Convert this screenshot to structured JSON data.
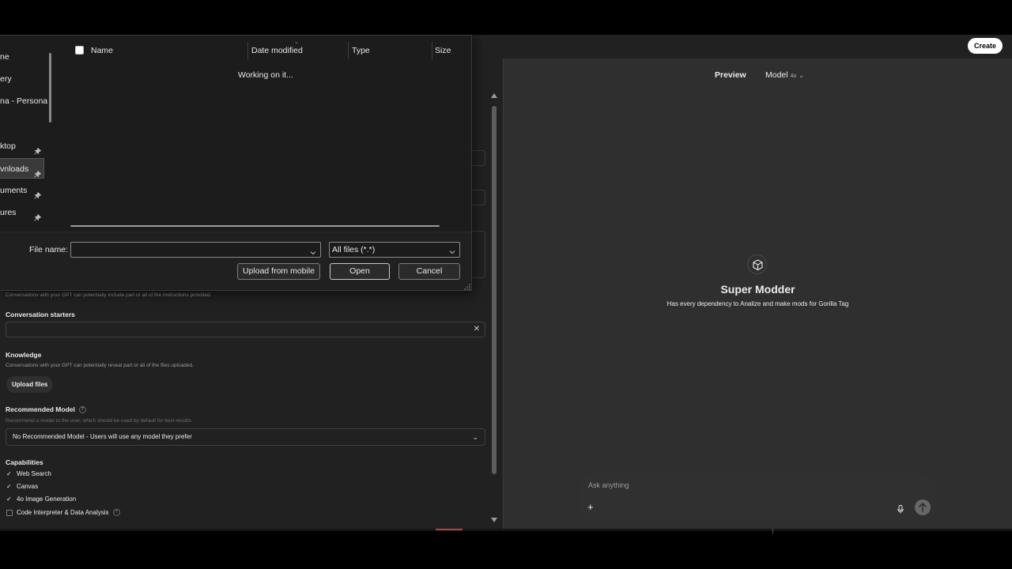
{
  "topbar": {
    "create_label": "Create"
  },
  "builder": {
    "instructions_hint": "Conversations with your GPT can potentially include part or all of the instructions provided.",
    "starters": {
      "label": "Conversation starters",
      "input_value": ""
    },
    "knowledge": {
      "label": "Knowledge",
      "hint": "Conversations with your GPT can potentially reveal part or all of the files uploaded.",
      "upload_label": "Upload files"
    },
    "recommended_model": {
      "label": "Recommended Model",
      "help": "?",
      "hint": "Recommend a model to the user, which should be used by default for best results.",
      "selected": "No Recommended Model - Users will use any model they prefer"
    },
    "capabilities": {
      "label": "Capabilities",
      "items": [
        {
          "label": "Web Search",
          "checked": true,
          "mark": "✓"
        },
        {
          "label": "Canvas",
          "checked": true,
          "mark": "✓"
        },
        {
          "label": "4o Image Generation",
          "checked": true,
          "mark": "✓"
        },
        {
          "label": "Code Interpreter & Data Analysis",
          "checked": false,
          "mark": "",
          "help": "?"
        }
      ]
    }
  },
  "preview": {
    "tab_label": "Preview",
    "model_label": "Model",
    "model_version": "4o",
    "gpt_name": "Super Modder",
    "gpt_description": "Has every dependency to Analize and make mods for Gorilla Tag",
    "composer_placeholder": "Ask anything",
    "plus": "+"
  },
  "file_dialog": {
    "nav_items": [
      {
        "label": "ne",
        "pinned": false
      },
      {
        "label": "ery",
        "pinned": false
      },
      {
        "label": "na - Personal",
        "pinned": false
      },
      {
        "label": "ktop",
        "pinned": true
      },
      {
        "label": "vnloads",
        "pinned": true,
        "selected": true
      },
      {
        "label": "uments",
        "pinned": true
      },
      {
        "label": "ures",
        "pinned": true
      }
    ],
    "columns": {
      "name": "Name",
      "date": "Date modified",
      "type": "Type",
      "size": "Size"
    },
    "status": "Working on it...",
    "file_name_label": "File name:",
    "file_name_value": "",
    "file_type": "All files (*.*)",
    "buttons": {
      "upload_mobile": "Upload from mobile",
      "open": "Open",
      "cancel": "Cancel"
    }
  },
  "colors": {
    "app_bg": "#212121",
    "preview_bg": "#2f2f2f",
    "dialog_bg": "#1c1c1c",
    "accent_white": "#ffffff"
  }
}
